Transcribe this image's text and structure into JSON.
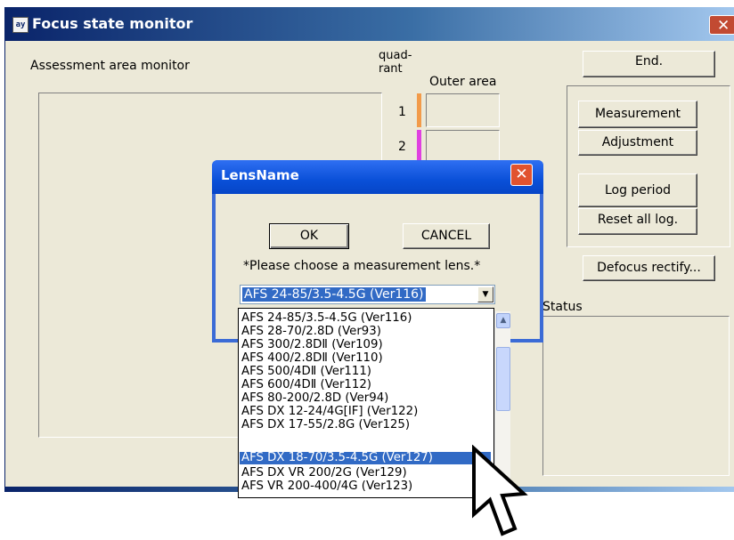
{
  "main_window": {
    "title": "Focus state monitor",
    "app_icon_text": "ay",
    "close_glyph": "✕",
    "assessment_label": "Assessment area monitor",
    "quadrant_header": "quad-\nrant",
    "outer_area_header": "Outer area",
    "quadrants": [
      {
        "number": "1",
        "color": "#f29b4a"
      },
      {
        "number": "2",
        "color": "#e040e0"
      }
    ],
    "buttons": {
      "end": "End.",
      "measurement": "Measurement",
      "adjustment": "Adjustment",
      "log_period": "Log period",
      "reset_all_log": "Reset all log.",
      "defocus_rectify": "Defocus rectify..."
    },
    "status_label": "Status"
  },
  "dialog": {
    "title": "LensName",
    "close_glyph": "✕",
    "ok_label": "OK",
    "cancel_label": "CANCEL",
    "instruction": "*Please choose a measurement lens.*",
    "selected_lens": "AFS 24-85/3.5-4.5G (Ver116)",
    "dropdown_arrow": "▼",
    "lens_options": [
      "AFS 24-85/3.5-4.5G (Ver116)",
      "AFS 28-70/2.8D (Ver93)",
      "AFS 300/2.8DⅡ (Ver109)",
      "AFS 400/2.8DⅡ (Ver110)",
      "AFS 500/4DⅡ (Ver111)",
      "AFS 600/4DⅡ (Ver112)",
      "AFS 80-200/2.8D (Ver94)",
      "AFS DX 12-24/4G[IF] (Ver122)",
      "AFS DX 17-55/2.8G (Ver125)",
      "AFS DX 18-70/3.5-4.5G (Ver127)",
      "AFS DX VR 200/2G (Ver129)",
      "AFS VR 200-400/4G (Ver123)"
    ],
    "highlighted_option": "AFS DX 18-70/3.5-4.5G (Ver127)",
    "scroll_up_glyph": "▲",
    "scroll_down_glyph": "▼"
  },
  "icons": {
    "app": "app-icon",
    "close": "close-icon",
    "cursor": "mouse-pointer-icon"
  }
}
